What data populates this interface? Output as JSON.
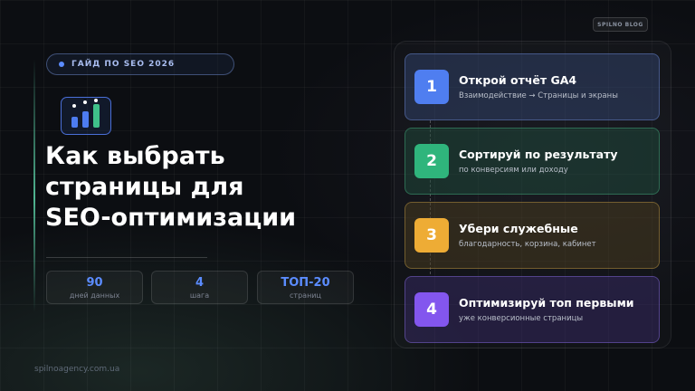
{
  "badge": {
    "label": "ГАЙД ПО SEO 2026"
  },
  "blog_tag": "SPILNO BLOG",
  "title_lines": [
    "Как выбрать",
    "страницы для",
    "SEO-оптимизации"
  ],
  "stats": [
    {
      "value": "90",
      "label": "дней данных"
    },
    {
      "value": "4",
      "label": "шага"
    },
    {
      "value": "ТОП-20",
      "label": "страниц"
    }
  ],
  "footer": "spilnoagency.com.ua",
  "steps": [
    {
      "number": "1",
      "title": "Открой отчёт GA4",
      "subtitle": "Взаимодействие → Страницы и экраны",
      "color": "#4f7ef0"
    },
    {
      "number": "2",
      "title": "Сортируй по результату",
      "subtitle": "по конверсиям или доходу",
      "color": "#2fb57c"
    },
    {
      "number": "3",
      "title": "Убери служебные",
      "subtitle": "благодарность, корзина, кабинет",
      "color": "#eeac35"
    },
    {
      "number": "4",
      "title": "Оптимизируй топ первыми",
      "subtitle": "уже конверсионные страницы",
      "color": "#8356ee"
    }
  ],
  "colors": {
    "accent_blue": "#5b8cff",
    "accent_green": "#3fc08a",
    "background": "#0c0e12"
  },
  "icons": {
    "logo": "bar-chart-icon"
  }
}
